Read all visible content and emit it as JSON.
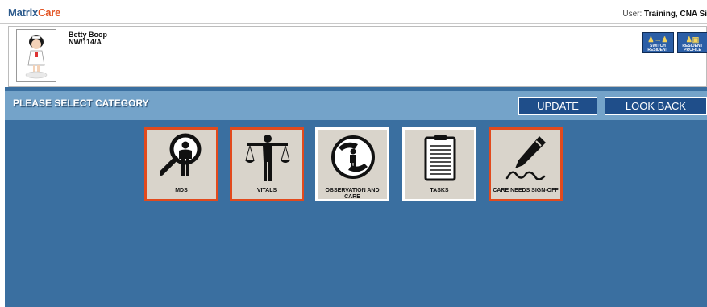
{
  "header": {
    "logo_part1": "Matrix",
    "logo_part2": "Care",
    "user_label": "User:",
    "user_value": "Training, CNA Si"
  },
  "resident": {
    "name": "Betty Boop",
    "room": "NW/114/A",
    "switch_label": "SWITCH RESIDENT",
    "profile_label": "RESIDENT PROFILE"
  },
  "category": {
    "title": "PLEASE SELECT CATEGORY",
    "update_label": "UPDATE",
    "lookback_label": "LOOK BACK"
  },
  "tiles": [
    {
      "label": "MDS",
      "icon": "magnifier-person-icon",
      "selected": true
    },
    {
      "label": "VITALS",
      "icon": "scale-person-icon",
      "selected": true
    },
    {
      "label": "OBSERVATION AND CARE",
      "icon": "hands-person-icon",
      "selected": false
    },
    {
      "label": "TASKS",
      "icon": "clipboard-icon",
      "selected": false
    },
    {
      "label": "CARE NEEDS SIGN-OFF",
      "icon": "pen-signature-icon",
      "selected": true
    }
  ],
  "colors": {
    "brand_blue": "#2c5a8c",
    "brand_orange": "#e2501e",
    "main_bg": "#3a6fa0",
    "category_bar": "#74a3c9",
    "button_bg": "#1f4e8a",
    "tile_bg": "#d9d4cb",
    "tile_selected_border": "#e24a1d"
  }
}
